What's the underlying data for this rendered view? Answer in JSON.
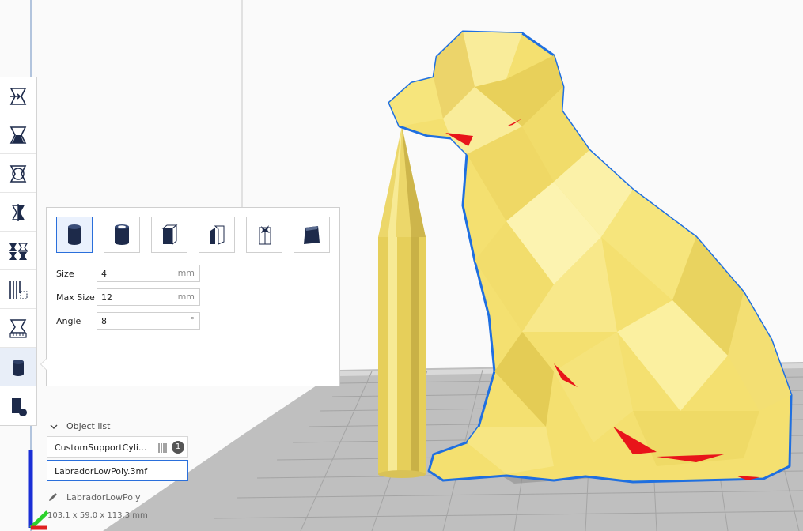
{
  "toolbar": {
    "tools": [
      {
        "name": "move-tool",
        "icon": "move-icon"
      },
      {
        "name": "scale-tool",
        "icon": "scale-icon"
      },
      {
        "name": "rotate-tool",
        "icon": "rotate-icon"
      },
      {
        "name": "mirror-tool",
        "icon": "mirror-icon"
      },
      {
        "name": "per-model-settings-tool",
        "icon": "per-model-settings-icon"
      },
      {
        "name": "support-blocker-tool",
        "icon": "support-blocker-icon"
      },
      {
        "name": "measure-tool",
        "icon": "measure-icon"
      },
      {
        "name": "custom-supports-tool",
        "icon": "cylinder-icon",
        "active": true
      },
      {
        "name": "support-eraser-tool",
        "icon": "eraser-icon"
      }
    ]
  },
  "support_panel": {
    "shapes": [
      "cylinder",
      "tube",
      "cube",
      "abutment",
      "freeform",
      "custom"
    ],
    "selected_shape": "cylinder",
    "size_label": "Size",
    "size_value": "4",
    "size_unit": "mm",
    "max_size_label": "Max Size",
    "max_size_value": "12",
    "max_size_unit": "mm",
    "angle_label": "Angle",
    "angle_value": "8",
    "angle_unit": "°"
  },
  "object_list": {
    "header": "Object list",
    "items": [
      {
        "name": "CustomSupportCyli...",
        "badge": "1"
      },
      {
        "name": "LabradorLowPoly.3mf"
      }
    ],
    "current_object": "LabradorLowPoly",
    "dimensions": "103.1 x 59.0 x 113.3 mm"
  },
  "colors": {
    "model_fill": "#f2dd6a",
    "selection_outline": "#1f6fe0",
    "overhang": "#e8141a",
    "build_plate": "#bdbdbd",
    "grid_line": "#a4a4a4"
  }
}
